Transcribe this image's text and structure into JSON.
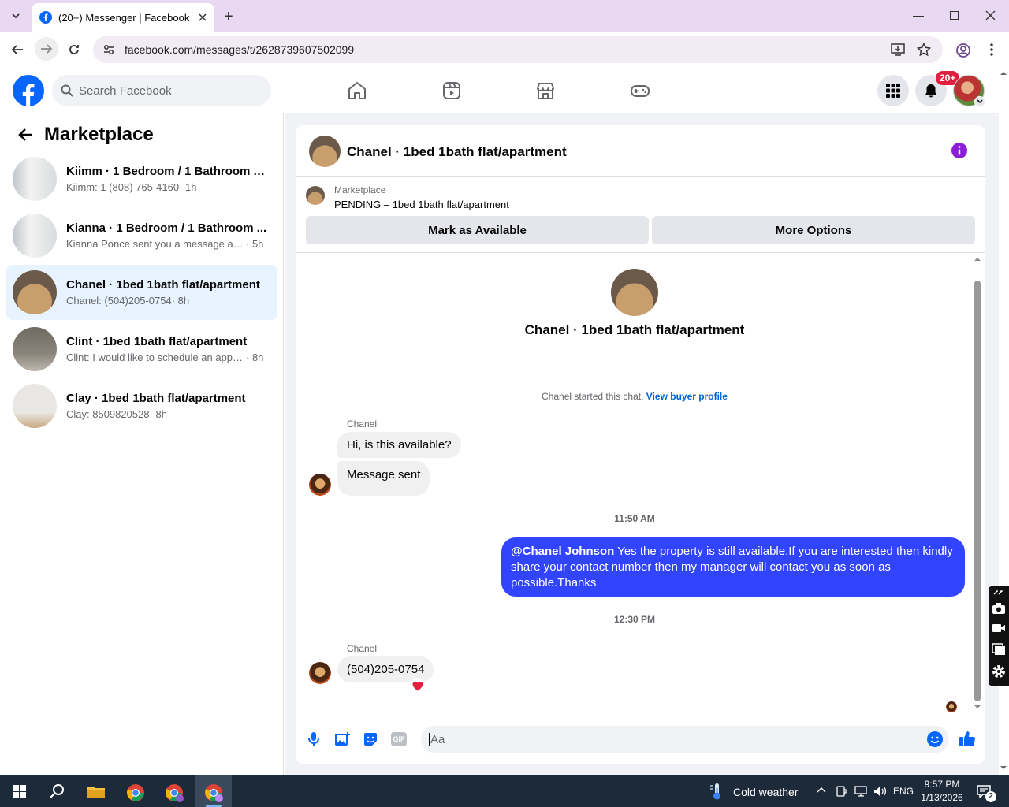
{
  "browser": {
    "tab_title": "(20+) Messenger | Facebook",
    "url": "facebook.com/messages/t/2628739607502099"
  },
  "fb": {
    "search_placeholder": "Search Facebook",
    "notif_badge": "20+"
  },
  "sidebar": {
    "title": "Marketplace",
    "conversations": [
      {
        "title": "Kiimm · 1 Bedroom / 1 Bathroom A...",
        "msg": "Kiimm: 1 (808) 765-4160",
        "time": "· 1h"
      },
      {
        "title": "Kianna · 1 Bedroom / 1 Bathroom ...",
        "msg": "Kianna Ponce sent you a message abo...",
        "time": "· 5h"
      },
      {
        "title": "Chanel · 1bed 1bath flat/apartment",
        "msg": "Chanel: (504)205-0754",
        "time": "· 8h"
      },
      {
        "title": "Clint · 1bed 1bath flat/apartment",
        "msg": "Clint: I would like to schedule an appo...",
        "time": "· 8h"
      },
      {
        "title": "Clay · 1bed 1bath flat/apartment",
        "msg": "Clay: 8509820528",
        "time": "· 8h"
      }
    ]
  },
  "chat": {
    "header_title": "Chanel · 1bed 1bath flat/apartment",
    "listing_label": "Marketplace",
    "listing_status": "PENDING – 1bed 1bath flat/apartment",
    "mark_available": "Mark as Available",
    "more_options": "More Options",
    "intro_title": "Chanel · 1bed 1bath flat/apartment",
    "started_text": "Chanel started this chat.",
    "view_profile": "View buyer profile",
    "sender1": "Chanel",
    "msg1": "Hi, is this available?",
    "msg2": "Message sent",
    "time1": "11:50 AM",
    "out_mention": "@Chanel Johnson",
    "out_text": " Yes the property is still available,If you are interested then kindly share your contact number then my manager will contact you as soon as possible.Thanks",
    "time2": "12:30 PM",
    "sender2": "Chanel",
    "msg3": "(504)205-0754",
    "composer_placeholder": "Aa"
  },
  "taskbar": {
    "weather": "Cold weather",
    "lang": "ENG",
    "time": "9:57 PM",
    "date": "1/13/2026",
    "notif_count": "2"
  },
  "colors": {
    "fb_blue": "#0866ff",
    "outgoing": "#3144ff",
    "active_conv": "#e7f3ff",
    "badge": "#e41e3f"
  }
}
